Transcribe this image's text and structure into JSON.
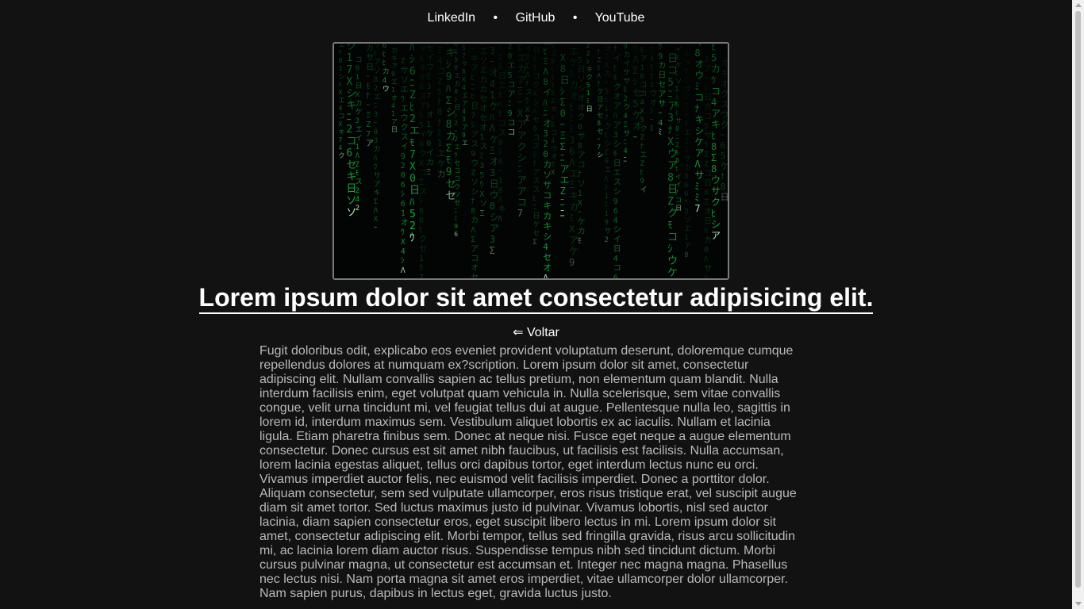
{
  "nav": {
    "links": [
      {
        "label": "LinkedIn"
      },
      {
        "label": "GitHub"
      },
      {
        "label": "YouTube"
      }
    ],
    "separator": "•"
  },
  "hero": {
    "icon": "matrix-code-rain-image",
    "accent_color": "#1fbf4a"
  },
  "article": {
    "title": "Lorem ipsum dolor sit amet consectetur adipisicing elit.",
    "back_label": "⇐ Voltar",
    "body": "Fugit doloribus odit, explicabo eos eveniet provident voluptatum deserunt, doloremque cumque repellendus dolores at numquam ex?scription. Lorem ipsum dolor sit amet, consectetur adipiscing elit. Nullam convallis sapien ac tellus pretium, non elementum quam blandit. Nulla interdum facilisis enim, eget volutpat quam vehicula in. Nulla scelerisque, sem vitae convallis congue, velit urna tincidunt mi, vel feugiat tellus dui at augue. Pellentesque nulla leo, sagittis in lorem id, interdum maximus sem. Vestibulum aliquet lobortis ex ac iaculis. Nullam et lacinia ligula. Etiam pharetra finibus sem. Donec at neque nisi. Fusce eget neque a augue elementum consectetur. Donec cursus est sit amet nibh faucibus, ut facilisis est facilisis. Nulla accumsan, lorem lacinia egestas aliquet, tellus orci dapibus tortor, eget interdum lectus nunc eu orci. Vivamus imperdiet auctor felis, nec euismod velit facilisis imperdiet. Donec a porttitor dolor. Aliquam consectetur, sem sed vulputate ullamcorper, eros risus tristique erat, vel suscipit augue diam sit amet tortor. Sed luctus maximus justo id pulvinar. Vivamus lobortis, nisl sed auctor lacinia, diam sapien consectetur eros, eget suscipit libero lectus in mi. Lorem ipsum dolor sit amet, consectetur adipiscing elit. Morbi tempor, tellus sed fringilla gravida, risus arcu sollicitudin mi, ac lacinia lorem diam auctor risus. Suspendisse tempus nibh sed tincidunt dictum. Morbi cursus pulvinar magna, ut consectetur est accumsan et. Integer nec magna magna. Phasellus nec lectus nisi. Nam porta magna sit amet eros imperdiet, vitae ullamcorper dolor ullamcorper. Nam sapien purus, dapibus in lectus eget, gravida luctus justo."
  }
}
